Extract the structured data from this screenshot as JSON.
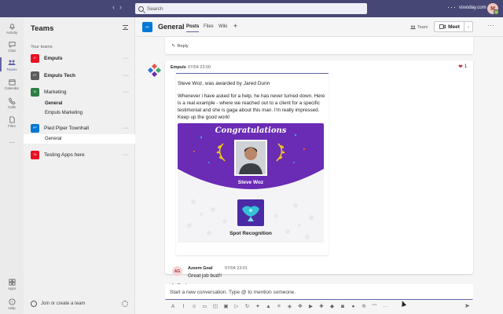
{
  "topbar": {
    "search_placeholder": "Search",
    "more": "···",
    "domain": "vsvoday.com",
    "avatar_initial": "M"
  },
  "rail": {
    "items": [
      {
        "label": "Activity",
        "icon": "bell-icon"
      },
      {
        "label": "Chat",
        "icon": "chat-icon"
      },
      {
        "label": "Teams",
        "icon": "teams-icon"
      },
      {
        "label": "Calendar",
        "icon": "calendar-icon"
      },
      {
        "label": "Calls",
        "icon": "phone-icon"
      },
      {
        "label": "Files",
        "icon": "file-icon"
      },
      {
        "label": "···",
        "icon": "more-icon"
      },
      {
        "label": "Apps",
        "icon": "apps-icon"
      },
      {
        "label": "Help",
        "icon": "help-icon"
      }
    ]
  },
  "teams_panel": {
    "title": "Teams",
    "section_label": "Your teams",
    "teams": [
      {
        "initials": "E",
        "name": "Empuls",
        "color": "#e81123"
      },
      {
        "initials": "ET",
        "name": "Empuls Tech",
        "color": "#5c5c5c"
      },
      {
        "initials": "M",
        "name": "Marketing",
        "color": "#2d7d46"
      },
      {
        "initials": "PP",
        "name": "Pied Piper Townhall",
        "color": "#0078d4"
      },
      {
        "initials": "TA",
        "name": "Testing Apps here",
        "color": "#e81123"
      }
    ],
    "channels": {
      "marketing": [
        "General",
        "Empuls Marketing"
      ],
      "pied_piper": [
        "General"
      ]
    },
    "join_label": "Join or create a team",
    "more": "···"
  },
  "channel_header": {
    "initials": "PP",
    "title": "General",
    "tabs": [
      "Posts",
      "Files",
      "Wiki"
    ],
    "add_tab": "+",
    "team_label": "Team",
    "meet_label": "Meet",
    "more": "···"
  },
  "thread": {
    "reply_label": "Reply",
    "post": {
      "author": "Empuls",
      "time": "07/04 23:00",
      "reaction_count": "1",
      "card": {
        "heading": "Steve Woz, was awarded by Jared Dunn",
        "body": "Whenever i have asked for a help, he has never turned down. Here is a real example - where we reached out to a client for a specific testimonial and she is gaga about this man. I'm really impressed. Keep up the good work!",
        "congrats_title": "Congratulations",
        "recipient": "Steve Woz",
        "award_name": "Spot Recognition",
        "accent_color": "#6a2bb5"
      },
      "reply": {
        "initials": "AG",
        "author": "Azeem Goal",
        "time": "07/04 23:01",
        "text": "Great job bud!!"
      }
    }
  },
  "compose": {
    "placeholder": "Start a new conversation. Type @ to mention someone."
  }
}
